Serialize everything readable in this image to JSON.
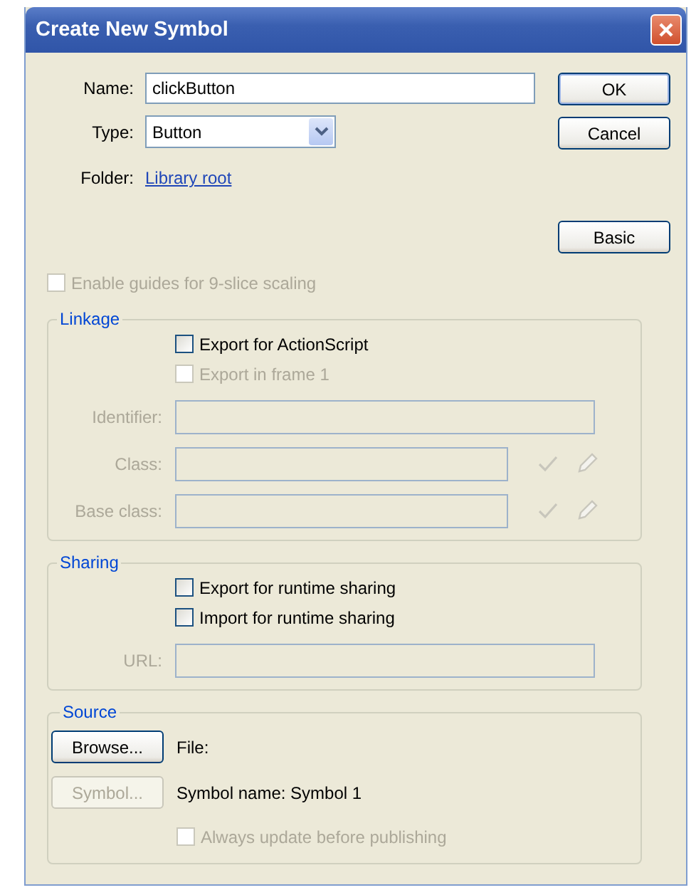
{
  "window": {
    "title": "Create New Symbol"
  },
  "name": {
    "label": "Name:",
    "value": "clickButton"
  },
  "type": {
    "label": "Type:",
    "value": "Button"
  },
  "folder": {
    "label": "Folder:",
    "link": "Library root"
  },
  "buttons": [
    {
      "label": "OK"
    },
    {
      "label": "Cancel"
    },
    {
      "label": "Basic"
    }
  ],
  "nine_slice": {
    "label": "Enable guides for 9-slice scaling",
    "checked": false,
    "disabled": true
  },
  "linkage": {
    "title": "Linkage",
    "checkboxes": [
      {
        "label": "Export for ActionScript",
        "checked": false,
        "disabled": false
      },
      {
        "label": "Export in frame 1",
        "checked": false,
        "disabled": true
      }
    ],
    "fields": [
      {
        "label": "Identifier:",
        "disabled": true,
        "tools": false
      },
      {
        "label": "Class:",
        "disabled": true,
        "tools": true
      },
      {
        "label": "Base class:",
        "disabled": true,
        "tools": true
      }
    ]
  },
  "sharing": {
    "title": "Sharing",
    "checkboxes": [
      {
        "label": "Export for runtime sharing",
        "checked": false,
        "disabled": false
      },
      {
        "label": "Import for runtime sharing",
        "checked": false,
        "disabled": false
      }
    ],
    "fields": [
      {
        "label": "URL:",
        "disabled": true,
        "tools": false
      }
    ]
  },
  "source": {
    "title": "Source",
    "buttons": [
      {
        "label": "Browse...",
        "disabled": false
      },
      {
        "label": "Symbol...",
        "disabled": true
      }
    ],
    "file_label": "File:",
    "symbol_name": "Symbol name: Symbol 1",
    "checkbox": {
      "label": "Always update before publishing",
      "checked": false,
      "disabled": true
    }
  }
}
